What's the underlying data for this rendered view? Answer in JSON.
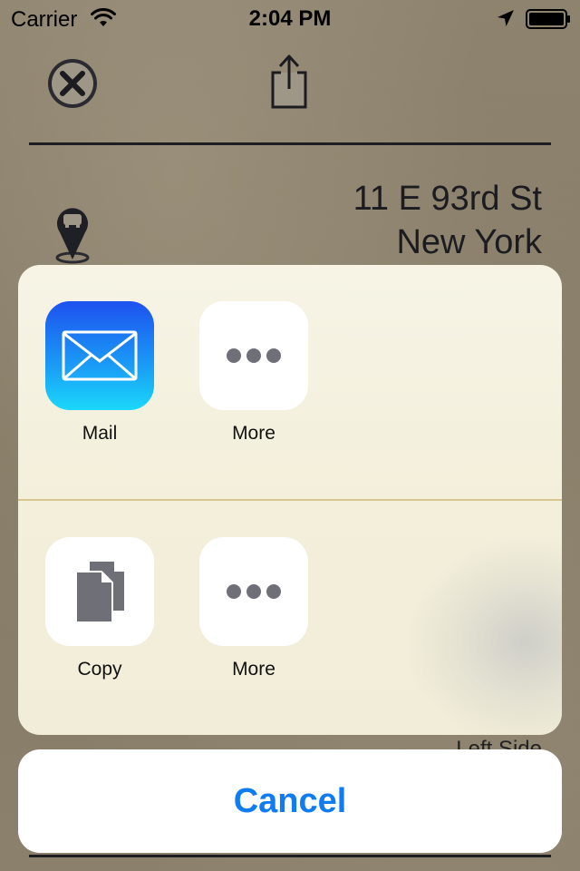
{
  "status_bar": {
    "carrier": "Carrier",
    "time": "2:04 PM",
    "icons": [
      "wifi-icon",
      "location-arrow-icon",
      "battery-icon"
    ]
  },
  "background_app": {
    "toolbar_icons": [
      "close-icon",
      "share-icon"
    ],
    "address_line1": "11 E 93rd St",
    "address_line2": "New York",
    "side_label": "Left Side",
    "pin_icon": "car-pin-icon"
  },
  "share_sheet": {
    "share_row": [
      {
        "label": "Mail",
        "icon": "mail-envelope-icon"
      },
      {
        "label": "More",
        "icon": "more-dots-icon"
      }
    ],
    "action_row": [
      {
        "label": "Copy",
        "icon": "copy-documents-icon"
      },
      {
        "label": "More",
        "icon": "more-dots-icon"
      }
    ],
    "separator_color": "#d6c790"
  },
  "cancel_label": "Cancel",
  "colors": {
    "accent": "#0f7cf2",
    "mail_gradient_top": "#1e51ef",
    "mail_gradient_bottom": "#1bd8fa",
    "dots": "#6f6f78"
  }
}
